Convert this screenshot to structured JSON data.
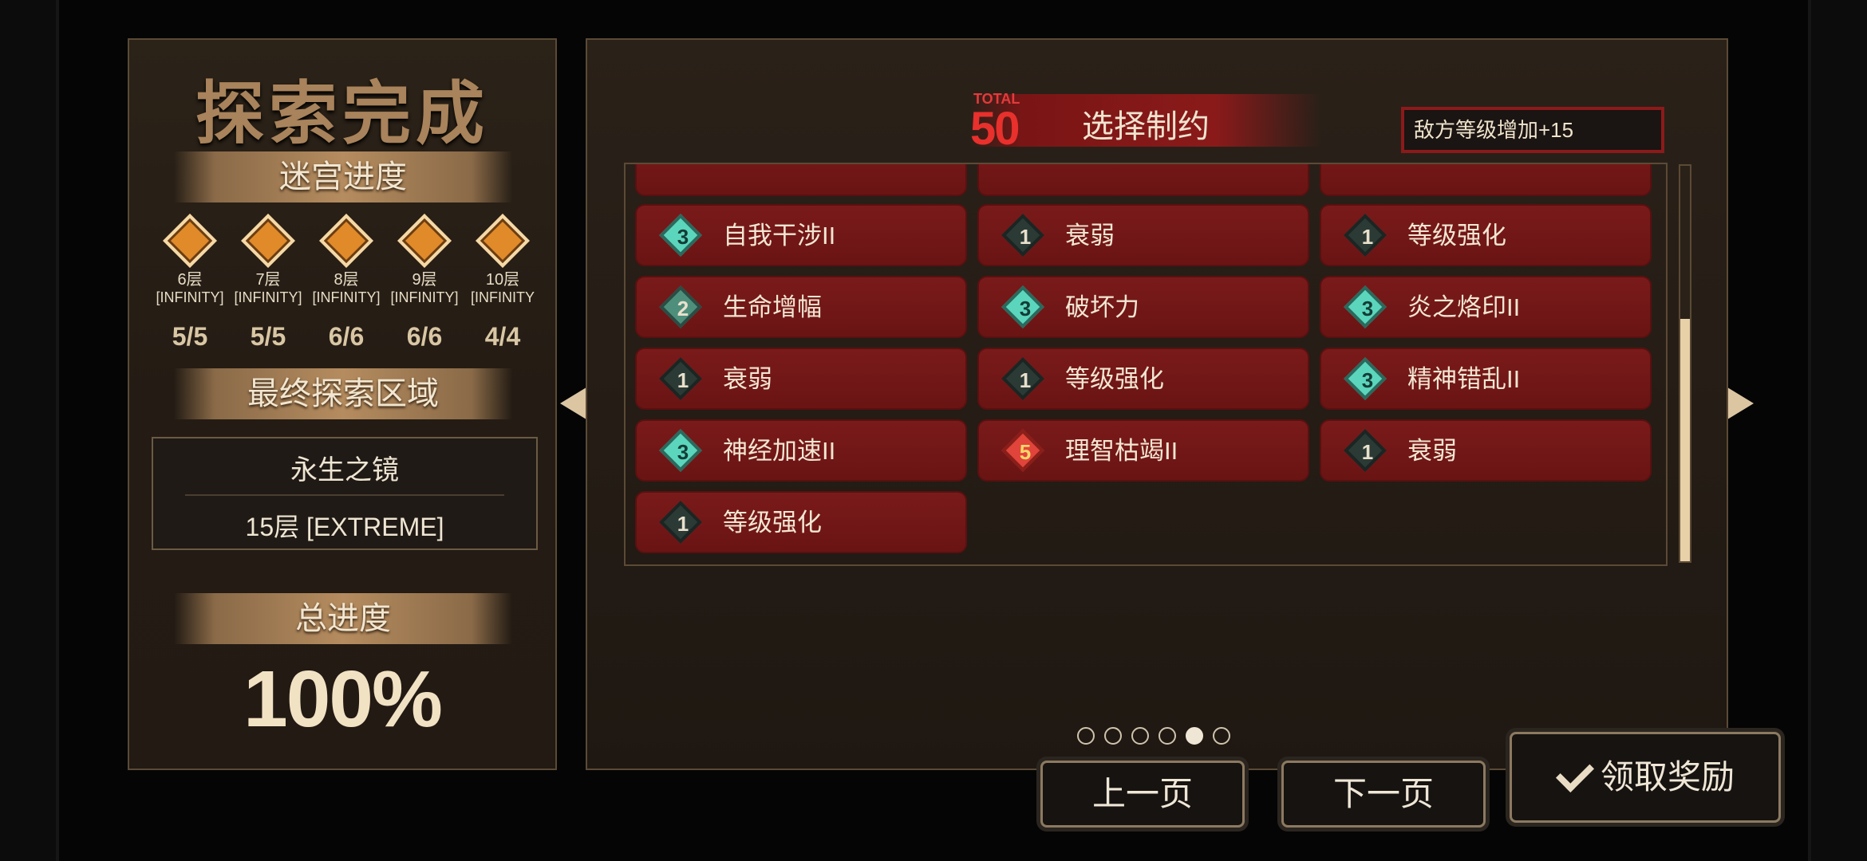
{
  "left": {
    "title": "探索完成",
    "maze_progress_label": "迷宫进度",
    "floors": [
      {
        "name": "6层",
        "tag": "[INFINITY]",
        "score": "5/5"
      },
      {
        "name": "7层",
        "tag": "[INFINITY]",
        "score": "5/5"
      },
      {
        "name": "8层",
        "tag": "[INFINITY]",
        "score": "6/6"
      },
      {
        "name": "9层",
        "tag": "[INFINITY]",
        "score": "6/6"
      },
      {
        "name": "10层",
        "tag": "[INFINITY",
        "score": "4/4"
      }
    ],
    "final_area_label": "最终探索区域",
    "final_area_name": "永生之镜",
    "final_area_floor": "15层 [EXTREME]",
    "total_progress_label": "总进度",
    "total_progress_value": "100%"
  },
  "right": {
    "total_label": "TOTAL",
    "total_value": "50",
    "title": "选择制约",
    "restriction": "敌方等级增加+15",
    "cards": [
      {
        "level": "3",
        "label": "自我干涉II"
      },
      {
        "level": "1",
        "label": "衰弱"
      },
      {
        "level": "1",
        "label": "等级强化"
      },
      {
        "level": "2",
        "label": "生命增幅"
      },
      {
        "level": "3",
        "label": "破坏力"
      },
      {
        "level": "3",
        "label": "炎之烙印II"
      },
      {
        "level": "1",
        "label": "衰弱"
      },
      {
        "level": "1",
        "label": "等级强化"
      },
      {
        "level": "3",
        "label": "精神错乱II"
      },
      {
        "level": "3",
        "label": "神经加速II"
      },
      {
        "level": "5",
        "label": "理智枯竭II"
      },
      {
        "level": "1",
        "label": "衰弱"
      },
      {
        "level": "1",
        "label": "等级强化"
      }
    ],
    "pagination": {
      "total_pages": 6,
      "current_page": 5
    }
  },
  "buttons": {
    "prev": "上一页",
    "next": "下一页",
    "claim": "领取奖励"
  },
  "colors": {
    "card_bg": "#7a1a1a",
    "total_red": "#e8302c",
    "accent_gold": "#a8835b"
  }
}
